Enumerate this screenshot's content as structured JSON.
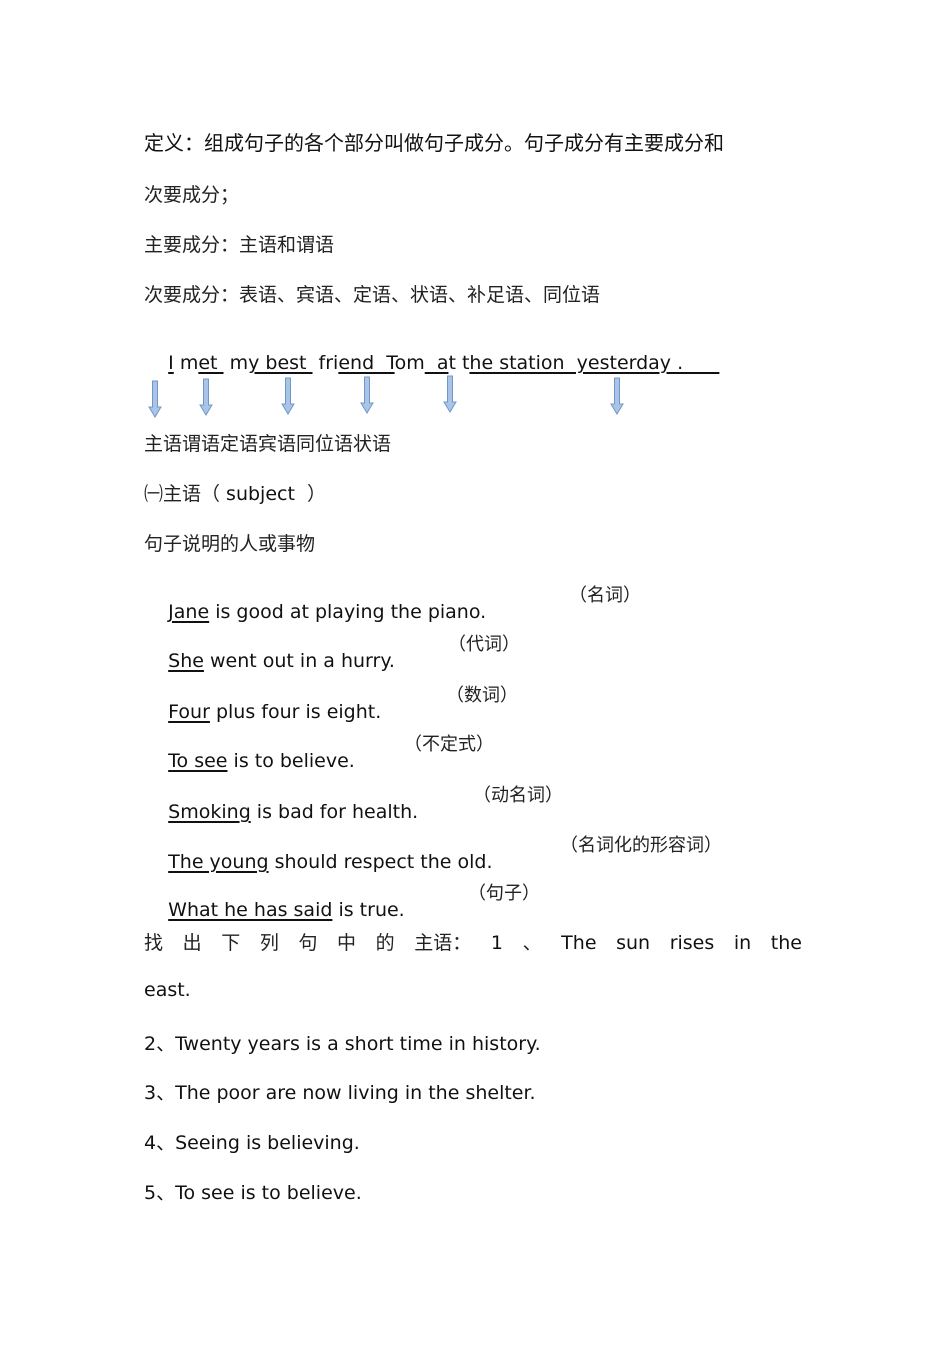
{
  "definition": {
    "line1": "定义：组成句子的各个部分叫做句子成分。句子成分有主要成分和",
    "line2": "次要成分；",
    "main_components": "主要成分：主语和谓语",
    "secondary_components": "次要成分：表语、宾语、定语、状语、补足语、同位语"
  },
  "example_sentence": {
    "segments": [
      {
        "text": "I",
        "underline": true
      },
      {
        "text": " m",
        "underline": false
      },
      {
        "text": "et ",
        "underline": true
      },
      {
        "text": " m",
        "underline": false
      },
      {
        "text": "y best ",
        "underline": true
      },
      {
        "text": " fri",
        "underline": false
      },
      {
        "text": "end  T",
        "underline": true
      },
      {
        "text": "om",
        "underline": false
      },
      {
        "text": "  a",
        "underline": true
      },
      {
        "text": "t t",
        "underline": false
      },
      {
        "text": "he station  yesterday .      ",
        "underline": true
      }
    ],
    "arrow_icon": "down-arrow-icon",
    "arrow_color": "#a9c4e6",
    "arrow_outline_color": "#6f97c8",
    "arrow_count": 6,
    "roles_line": "主语谓语定语宾语同位语状语"
  },
  "subject_section": {
    "heading_prefix": "㈠主语（",
    "heading_en": " subject ",
    "heading_suffix": " ）",
    "description": "句子说明的人或事物",
    "examples": [
      {
        "subject": "Jane",
        "rest": " is good at playing the piano.",
        "note": "（名词）"
      },
      {
        "subject": "She",
        "rest": " went out in a hurry.",
        "note": "（代词）"
      },
      {
        "subject": "Four",
        "rest": " plus four is eight.",
        "note": "（数词）"
      },
      {
        "subject": "To see",
        "rest": " is to believe.",
        "note": "（不定式）"
      },
      {
        "subject": "Smoking",
        "rest": " is bad for health.",
        "note": "（动名词）"
      },
      {
        "subject": "The young",
        "rest": " should respect the old.",
        "note": "（名词化的形容词）"
      },
      {
        "subject": "What he has said",
        "rest": " is true.",
        "note": "（句子）"
      }
    ]
  },
  "exercise": {
    "prompt_chars": [
      "找",
      "出",
      "下",
      "列",
      "句",
      "中",
      "的",
      "主语：",
      "1",
      "、",
      "The",
      "sun",
      "rises",
      "in",
      "the"
    ],
    "line1_continuation": "east.",
    "items": [
      "2、Twenty years is a short time in history.",
      "3、The poor are now living in the shelter.",
      "4、Seeing is believing.",
      "5、To see is to believe."
    ]
  }
}
